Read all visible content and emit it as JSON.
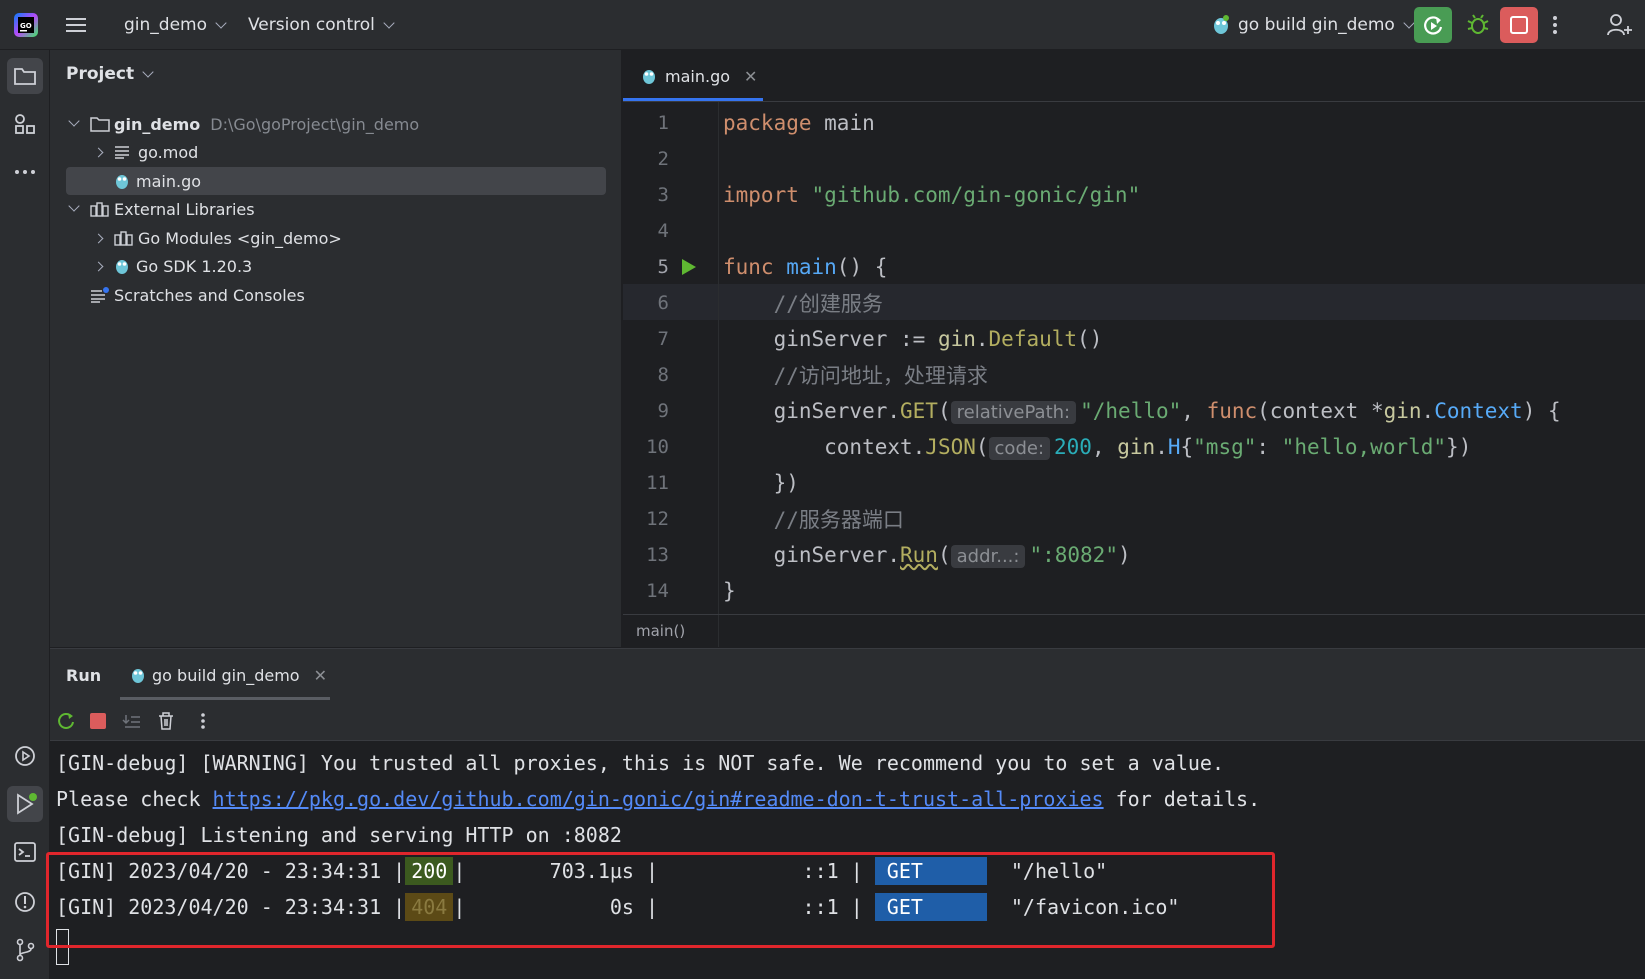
{
  "titlebar": {
    "project_name": "gin_demo",
    "vcs_label": "Version control",
    "run_config": "go build gin_demo"
  },
  "project_panel": {
    "title": "Project",
    "tree": [
      {
        "label": "gin_demo",
        "path": "D:\\Go\\goProject\\gin_demo",
        "icon": "folder-icon",
        "expanded": true
      },
      {
        "label": "go.mod",
        "icon": "file-lines-icon"
      },
      {
        "label": "main.go",
        "icon": "gopher-file-icon",
        "selected": true
      },
      {
        "label": "External Libraries",
        "icon": "library-icon",
        "expanded": true
      },
      {
        "label": "Go Modules <gin_demo>",
        "icon": "library-icon"
      },
      {
        "label": "Go SDK 1.20.3",
        "icon": "gopher-icon"
      },
      {
        "label": "Scratches and Consoles",
        "icon": "scratches-icon"
      }
    ]
  },
  "editor": {
    "tab_label": "main.go",
    "breadcrumb": "main()",
    "line_numbers": [
      "1",
      "2",
      "3",
      "4",
      "5",
      "6",
      "7",
      "8",
      "9",
      "10",
      "11",
      "12",
      "13",
      "14"
    ],
    "code": {
      "l1_kw": "package",
      "l1_name": " main",
      "l3_kw": "import",
      "l3_str": " \"github.com/gin-gonic/gin\"",
      "l5_kw": "func",
      "l5_fn": " main",
      "l5_rest": "() {",
      "l6_cmt": "    //创建服务",
      "l7_a": "    ginServer := ",
      "l7_pkg": "gin",
      "l7_dot": ".",
      "l7_call": "Default",
      "l7_end": "()",
      "l8_cmt": "    //访问地址，处理请求",
      "l9_a": "    ginServer.",
      "l9_call": "GET",
      "l9_paren": "(",
      "l9_hint": "relativePath:",
      "l9_str": "\"/hello\"",
      "l9_comma": ", ",
      "l9_kw": "func",
      "l9_params": "(context *",
      "l9_pkg": "gin",
      "l9_dot": ".",
      "l9_type": "Context",
      "l9_end": ") {",
      "l10_a": "        context.",
      "l10_call": "JSON",
      "l10_paren": "(",
      "l10_hint": "code:",
      "l10_num": "200",
      "l10_comma": ", ",
      "l10_pkg": "gin",
      "l10_dot": ".",
      "l10_h": "H",
      "l10_brace": "{",
      "l10_k": "\"msg\"",
      "l10_colon": ": ",
      "l10_v": "\"hello,world\"",
      "l10_end": "})",
      "l11": "    })",
      "l12_cmt": "    //服务器端口",
      "l13_a": "    ginServer.",
      "l13_call": "Run",
      "l13_paren": "(",
      "l13_hint": "addr...:",
      "l13_str": "\":8082\"",
      "l13_end": ")",
      "l14": "}"
    }
  },
  "run_panel": {
    "tab_run": "Run",
    "tab_config": "go build gin_demo",
    "console": {
      "line1": "[GIN-debug] [WARNING] You trusted all proxies, this is NOT safe. We recommend you to set a value.",
      "line2_pre": "Please check ",
      "line2_link": "https://pkg.go.dev/github.com/gin-gonic/gin#readme-don-t-trust-all-proxies",
      "line2_post": " for details.",
      "line3": "[GIN-debug] Listening and serving HTTP on :8082",
      "req1": {
        "prefix": "[GIN] 2023/04/20 - 23:34:31 |",
        "status": "200",
        "latency": "|       703.1µs |",
        "ip": "            ::1 |",
        "method": "GET",
        "path": "\"/hello\""
      },
      "req2": {
        "prefix": "[GIN] 2023/04/20 - 23:34:31 |",
        "status": "404",
        "latency": "|            0s |",
        "ip": "            ::1 |",
        "method": "GET",
        "path": "\"/favicon.ico\""
      }
    }
  },
  "colors": {
    "accent": "#3574f0",
    "run_green": "#499c54",
    "stop_red": "#db5c5c",
    "highlight_box": "#e0262c"
  }
}
